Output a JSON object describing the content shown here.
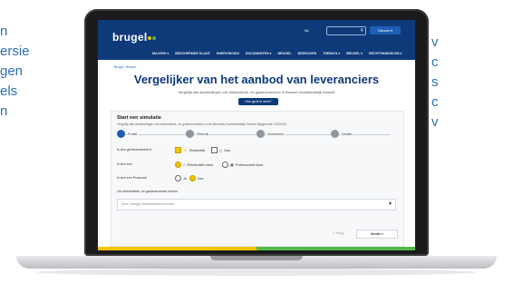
{
  "side_left": {
    "lines": [
      "n",
      "ersie",
      "gen",
      "els",
      "n"
    ]
  },
  "side_right": {
    "lines": [
      "v",
      "c",
      "s",
      "c",
      "v"
    ]
  },
  "site": {
    "logo": "brugel",
    "lang": "NL",
    "search_placeholder": "",
    "header_button": "Nieuws ▾",
    "nav": [
      "MAJORS ▾",
      "BESCHERMDE KLANT",
      "ENERGIEGIDS",
      "DOCUMENTEN ▾",
      "BRUGEL",
      "BEDRIJVEN",
      "THEMA'S ▾",
      "BRUGEL ▾",
      "RECHTSMIDDELEN ▾"
    ],
    "breadcrumb": "Brugel / Brusim",
    "title": "Vergelijker van het aanbod van leveranciers",
    "subtitle": "Vergelijk alle aanbiedingen van elektriciteits- en gasleveranciers in Brussel Hoofdstedelijk Gewest",
    "cta": "Hoe ga ik te werk?"
  },
  "sim": {
    "title": "Start een simulatie",
    "subtitle": "Vergelijk alle aanbiedingen van elektriciteits- en gasleveranciers in het Brussels Hoofdstedelijk Gewest (Bijgewerkt: 03/2024)",
    "steps": [
      "Profiel",
      "Verbruik",
      "Voorkeuren",
      "Details"
    ],
    "q1": {
      "label": "Ik ben geïnteresseerd in",
      "opt_a": "Elektriciteit",
      "opt_b": "Gas"
    },
    "q2": {
      "label": "Ik ben een",
      "opt_a": "Residentiële klant",
      "opt_b": "Professionele klant"
    },
    "q3": {
      "label": "Ik ben een Prosumer",
      "opt_a": "Ja",
      "opt_b": "Nee"
    },
    "note": "Uw elektriciteits- en gasleverancier kiezen",
    "select_placeholder": "Kies: Huidige elektriciteitsleverancier",
    "prev": "< Terug",
    "next": "Verder >"
  },
  "colors": {
    "primary": "#0f3a7a",
    "accent_yellow": "#f2c300",
    "accent_green": "#54b848",
    "side_text": "#2c6fb7"
  }
}
